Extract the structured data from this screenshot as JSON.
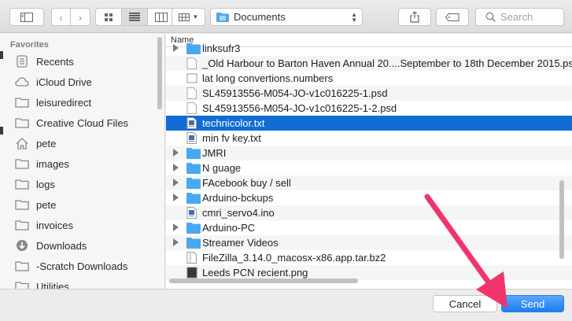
{
  "toolbar": {
    "location": "Documents",
    "search_placeholder": "Search",
    "view_modes": [
      "icon",
      "list",
      "column"
    ]
  },
  "sidebar": {
    "section": "Favorites",
    "items": [
      {
        "label": "Recents",
        "icon": "recents-icon"
      },
      {
        "label": "iCloud Drive",
        "icon": "cloud-icon"
      },
      {
        "label": "leisuredirect",
        "icon": "folder-icon"
      },
      {
        "label": "Creative Cloud Files",
        "icon": "folder-icon"
      },
      {
        "label": "pete",
        "icon": "home-icon"
      },
      {
        "label": "images",
        "icon": "folder-icon"
      },
      {
        "label": "logs",
        "icon": "folder-icon"
      },
      {
        "label": "pete",
        "icon": "folder-icon"
      },
      {
        "label": "invoices",
        "icon": "folder-icon"
      },
      {
        "label": "Downloads",
        "icon": "downloads-icon"
      },
      {
        "label": "-Scratch Downloads",
        "icon": "folder-icon"
      },
      {
        "label": "Utilities",
        "icon": "folder-icon"
      }
    ]
  },
  "file_list": {
    "column_header": "Name",
    "rows": [
      {
        "name": "linksufr3",
        "kind": "folder",
        "expandable": true
      },
      {
        "name": "_Old Harbour to Barton Haven Annual 20....September to 18th December 2015.psd",
        "kind": "doc",
        "expandable": false
      },
      {
        "name": "lat long convertions.numbers",
        "kind": "numbers",
        "expandable": false
      },
      {
        "name": "SL45913556-M054-JO-v1c016225-1.psd",
        "kind": "doc",
        "expandable": false
      },
      {
        "name": "SL45913556-M054-JO-v1c016225-1-2.psd",
        "kind": "doc",
        "expandable": false
      },
      {
        "name": "technicolor.txt",
        "kind": "txt",
        "expandable": false,
        "selected": true
      },
      {
        "name": "min fv key.txt",
        "kind": "txt",
        "expandable": false
      },
      {
        "name": "JMRI",
        "kind": "folder",
        "expandable": true
      },
      {
        "name": "N guage",
        "kind": "folder",
        "expandable": true
      },
      {
        "name": "FAcebook buy / sell",
        "kind": "folder",
        "expandable": true
      },
      {
        "name": "Arduino-bckups",
        "kind": "folder",
        "expandable": true
      },
      {
        "name": "cmri_servo4.ino",
        "kind": "ino",
        "expandable": false
      },
      {
        "name": "Arduino-PC",
        "kind": "folder",
        "expandable": true
      },
      {
        "name": "Streamer Videos",
        "kind": "folder",
        "expandable": true
      },
      {
        "name": "FileZilla_3.14.0_macosx-x86.app.tar.bz2",
        "kind": "archive",
        "expandable": false
      },
      {
        "name": "Leeds PCN recient.png",
        "kind": "image",
        "expandable": false
      }
    ]
  },
  "buttons": {
    "cancel": "Cancel",
    "send": "Send"
  },
  "colors": {
    "selection": "#116cd6",
    "folder": "#4aa8f0",
    "annotation_arrow": "#f0356c"
  }
}
